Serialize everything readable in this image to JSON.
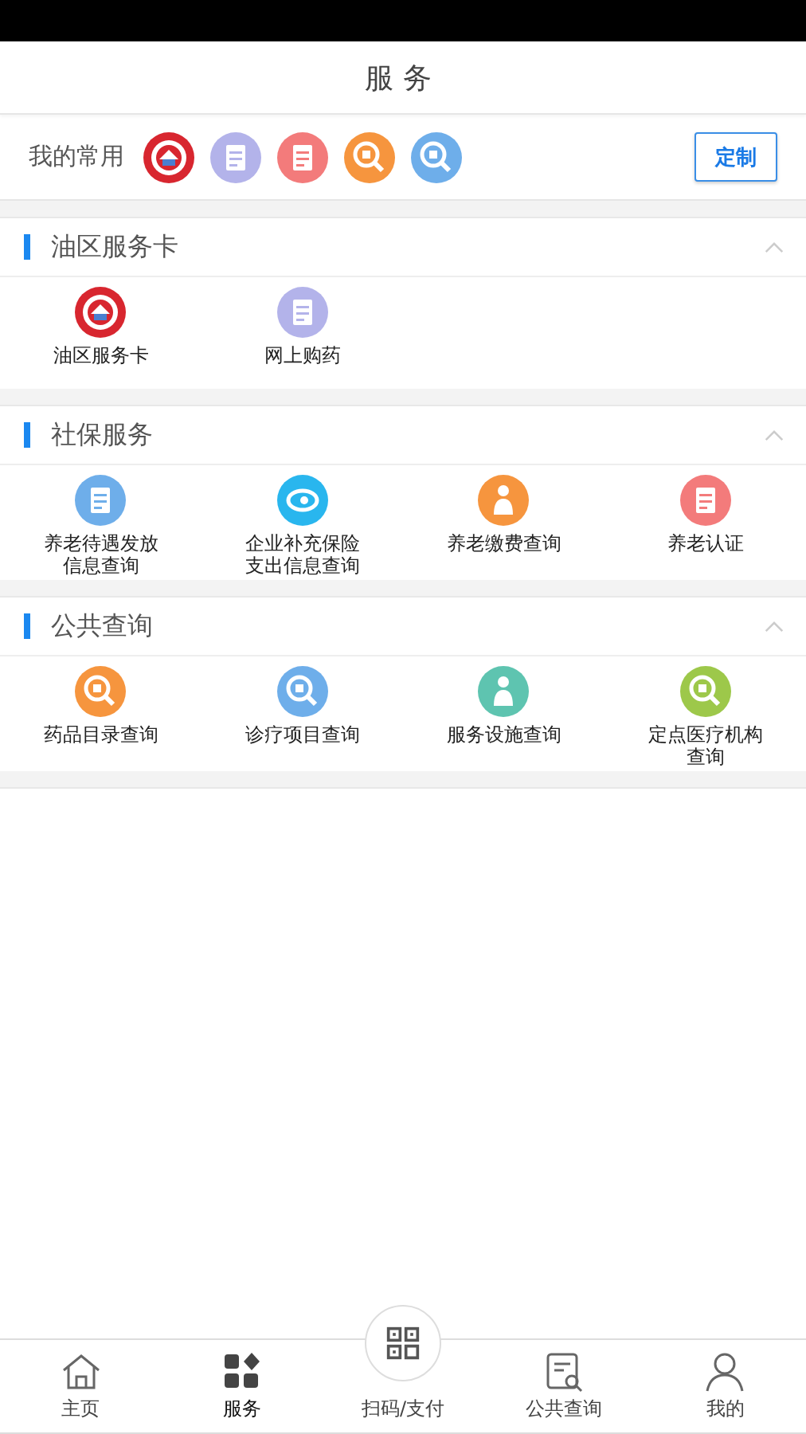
{
  "header": {
    "title": "服务"
  },
  "favorites": {
    "label": "我的常用",
    "icons": [
      {
        "kind": "emblem",
        "color": "#d8262f"
      },
      {
        "kind": "doc",
        "color": "#b3b3ea"
      },
      {
        "kind": "doc",
        "color": "#f37b7b"
      },
      {
        "kind": "search",
        "color": "#f6953e"
      },
      {
        "kind": "search",
        "color": "#6eaeea"
      }
    ],
    "button": "定制"
  },
  "sections": [
    {
      "title": "油区服务卡",
      "expanded": true,
      "items": [
        {
          "label": "油区服务卡",
          "kind": "emblem",
          "color": "#d8262f"
        },
        {
          "label": "网上购药",
          "kind": "doc",
          "color": "#b3b3ea"
        }
      ]
    },
    {
      "title": "社保服务",
      "expanded": true,
      "items": [
        {
          "label": "养老待遇发放信息查询",
          "kind": "doc",
          "color": "#6eaeea"
        },
        {
          "label": "企业补充保险支出信息查询",
          "kind": "ring",
          "color": "#29b6ee"
        },
        {
          "label": "养老缴费查询",
          "kind": "person",
          "color": "#f6953e"
        },
        {
          "label": "养老认证",
          "kind": "doc",
          "color": "#f37b7b"
        }
      ]
    },
    {
      "title": "公共查询",
      "expanded": true,
      "items": [
        {
          "label": "药品目录查询",
          "kind": "search",
          "color": "#f6953e"
        },
        {
          "label": "诊疗项目查询",
          "kind": "search",
          "color": "#6eaeea"
        },
        {
          "label": "服务设施查询",
          "kind": "person",
          "color": "#5ec4b0"
        },
        {
          "label": "定点医疗机构查询",
          "kind": "search",
          "color": "#9dc84a"
        }
      ]
    }
  ],
  "tabbar": [
    {
      "label": "主页",
      "kind": "home",
      "selected": false
    },
    {
      "label": "服务",
      "kind": "grid",
      "selected": true
    },
    {
      "label": "扫码/支付",
      "kind": "qr",
      "selected": false
    },
    {
      "label": "公共查询",
      "kind": "query",
      "selected": false
    },
    {
      "label": "我的",
      "kind": "user",
      "selected": false
    }
  ]
}
